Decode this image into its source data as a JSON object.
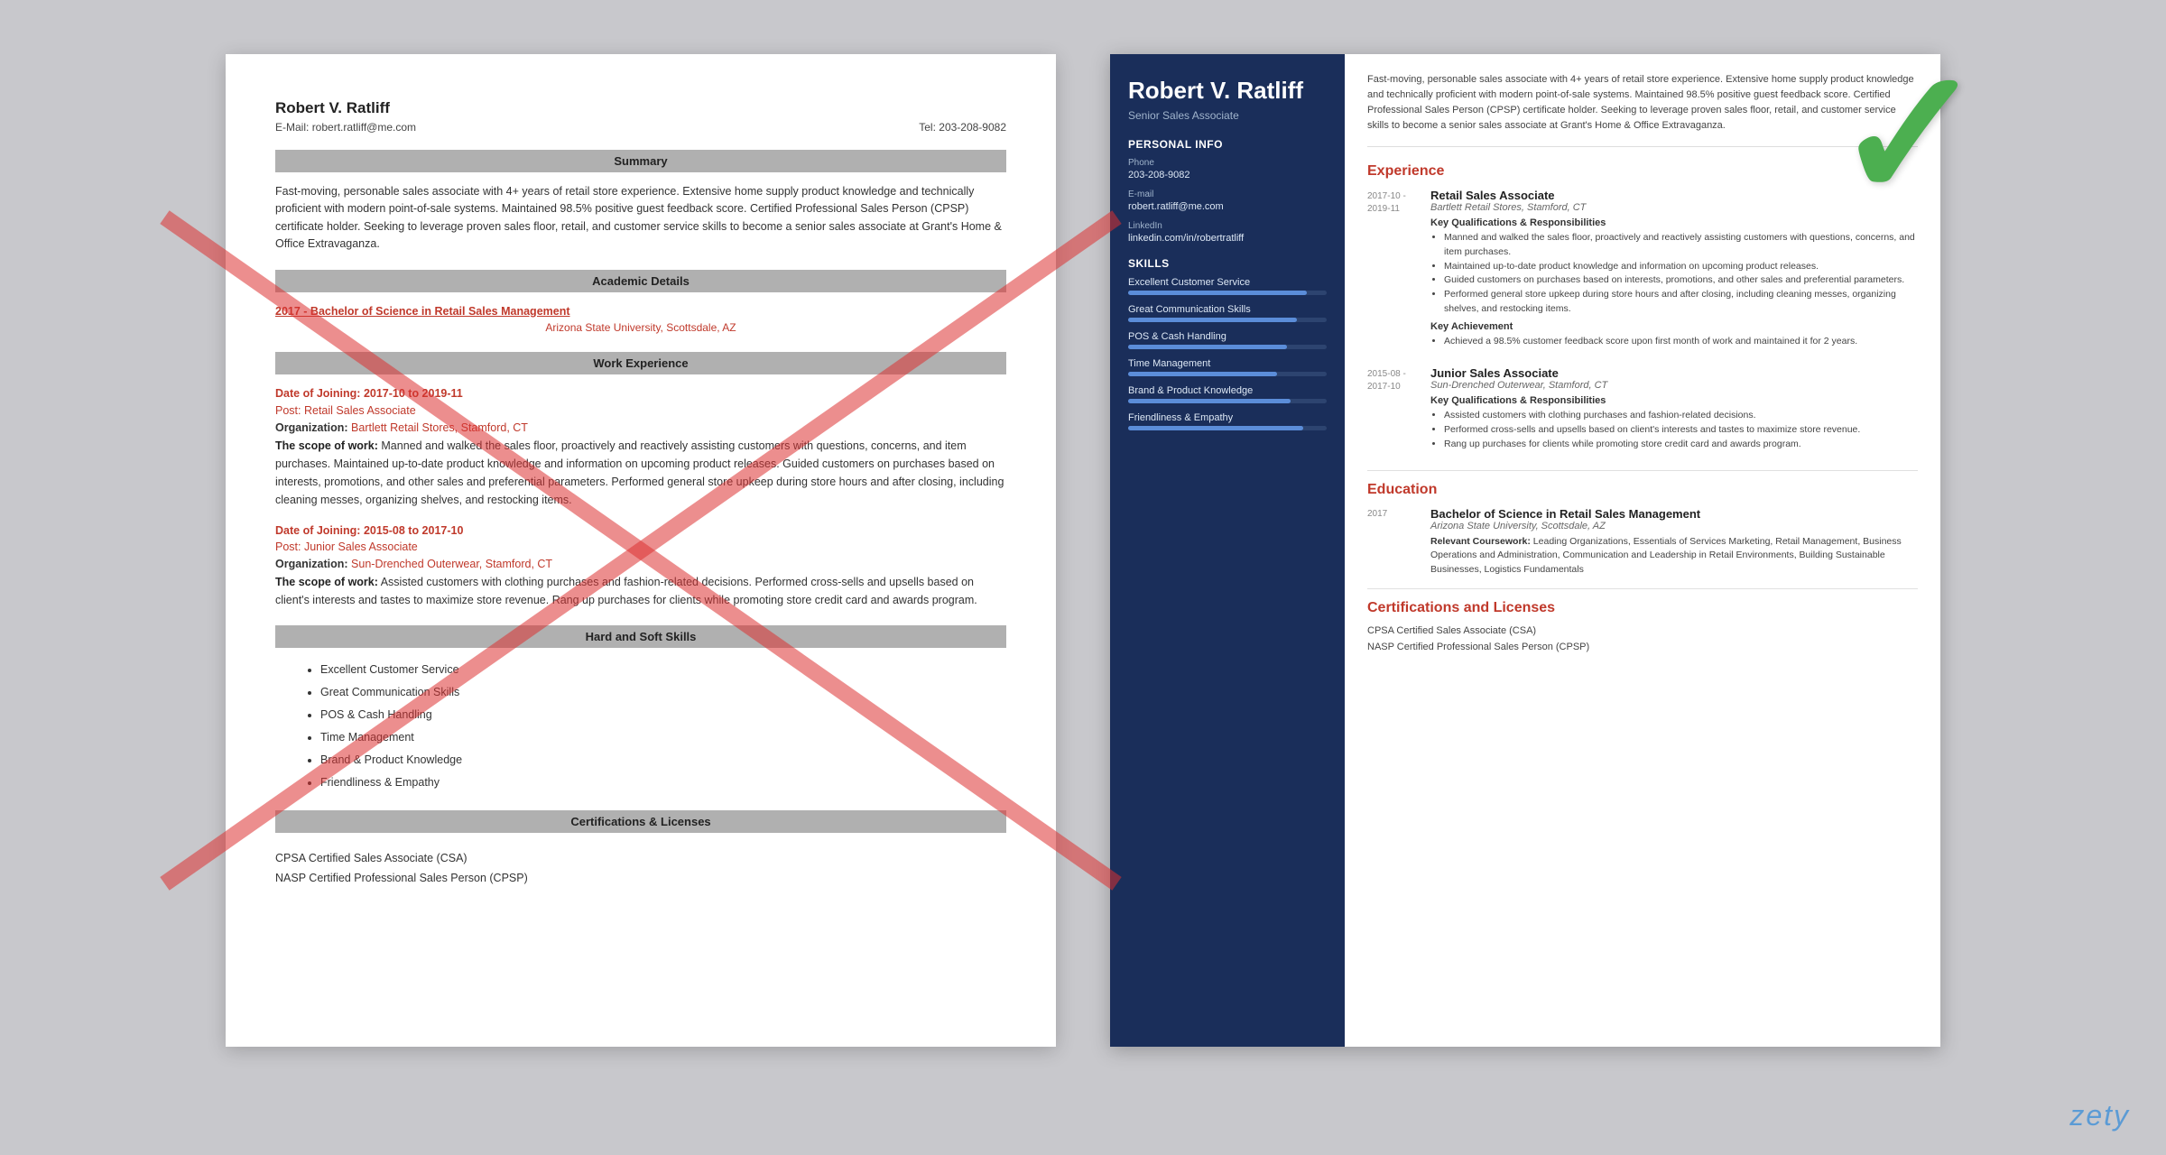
{
  "bad_resume": {
    "header": {
      "name": "Robert V. Ratliff",
      "email_label": "E-Mail:",
      "email": "robert.ratliff@me.com",
      "tel_label": "Tel:",
      "phone": "203-208-9082"
    },
    "sections": {
      "summary_title": "Summary",
      "summary_text": "Fast-moving, personable sales associate with 4+ years of retail store experience. Extensive home supply product knowledge and technically proficient with modern point-of-sale systems. Maintained 98.5% positive guest feedback score. Certified Professional Sales Person (CPSP) certificate holder. Seeking to leverage proven sales floor, retail, and customer service skills to become a senior sales associate at Grant's Home & Office Extravaganza.",
      "academic_title": "Academic Details",
      "academic_degree": "2017 - Bachelor of Science in Retail Sales Management",
      "academic_school": "Arizona State University, Scottsdale, AZ",
      "work_title": "Work Experience",
      "jobs": [
        {
          "date_label": "Date of Joining:",
          "dates": "2017-10 to 2019-11",
          "post_label": "Post:",
          "post": "Retail Sales Associate",
          "org_label": "Organization:",
          "org": "Bartlett Retail Stores, Stamford, CT",
          "scope_label": "The scope of work:",
          "scope": "Manned and walked the sales floor, proactively and reactively assisting customers with questions, concerns, and item purchases. Maintained up-to-date product knowledge and information on upcoming product releases. Guided customers on purchases based on interests, promotions, and other sales and preferential parameters. Performed general store upkeep during store hours and after closing, including cleaning messes, organizing shelves, and restocking items."
        },
        {
          "date_label": "Date of Joining:",
          "dates": "2015-08 to 2017-10",
          "post_label": "Post:",
          "post": "Junior Sales Associate",
          "org_label": "Organization:",
          "org": "Sun-Drenched Outerwear, Stamford, CT",
          "scope_label": "The scope of work:",
          "scope": "Assisted customers with clothing purchases and fashion-related decisions. Performed cross-sells and upsells based on client's interests and tastes to maximize store revenue. Rang up purchases for clients while promoting store credit card and awards program."
        }
      ],
      "skills_title": "Hard and Soft Skills",
      "skills": [
        "Excellent Customer Service",
        "Great Communication Skills",
        "POS & Cash Handling",
        "Time Management",
        "Brand & Product Knowledge",
        "Friendliness & Empathy"
      ],
      "certs_title": "Certifications & Licenses",
      "certs": [
        "CPSA Certified Sales Associate (CSA)",
        "NASP Certified Professional Sales Person (CPSP)"
      ]
    }
  },
  "good_resume": {
    "sidebar": {
      "name": "Robert V. Ratliff",
      "title": "Senior Sales Associate",
      "personal_title": "Personal Info",
      "phone_label": "Phone",
      "phone": "203-208-9082",
      "email_label": "E-mail",
      "email": "robert.ratliff@me.com",
      "linkedin_label": "LinkedIn",
      "linkedin": "linkedin.com/in/robertratliff",
      "skills_title": "Skills",
      "skills": [
        {
          "name": "Excellent Customer Service",
          "pct": 90
        },
        {
          "name": "Great Communication Skills",
          "pct": 85
        },
        {
          "name": "POS & Cash Handling",
          "pct": 80
        },
        {
          "name": "Time Management",
          "pct": 75
        },
        {
          "name": "Brand & Product Knowledge",
          "pct": 82
        },
        {
          "name": "Friendliness & Empathy",
          "pct": 88
        }
      ]
    },
    "main": {
      "summary": "Fast-moving, personable sales associate with 4+ years of retail store experience. Extensive home supply product knowledge and technically proficient with modern point-of-sale systems. Maintained 98.5% positive guest feedback score. Certified Professional Sales Person (CPSP) certificate holder. Seeking to leverage proven sales floor, retail, and customer service skills to become a senior sales associate at Grant's Home & Office Extravaganza.",
      "experience_title": "Experience",
      "jobs": [
        {
          "dates": "2017-10 - 2019-11",
          "title": "Retail Sales Associate",
          "org": "Bartlett Retail Stores, Stamford, CT",
          "key_qual_title": "Key Qualifications & Responsibilities",
          "bullets": [
            "Manned and walked the sales floor, proactively and reactively assisting customers with questions, concerns, and item purchases.",
            "Maintained up-to-date product knowledge and information on upcoming product releases.",
            "Guided customers on purchases based on interests, promotions, and other sales and preferential parameters.",
            "Performed general store upkeep during store hours and after closing, including cleaning messes, organizing shelves, and restocking items."
          ],
          "achievement_title": "Key Achievement",
          "achievement": "Achieved a 98.5% customer feedback score upon first month of work and maintained it for 2 years."
        },
        {
          "dates": "2015-08 - 2017-10",
          "title": "Junior Sales Associate",
          "org": "Sun-Drenched Outerwear, Stamford, CT",
          "key_qual_title": "Key Qualifications & Responsibilities",
          "bullets": [
            "Assisted customers with clothing purchases and fashion-related decisions.",
            "Performed cross-sells and upsells based on client's interests and tastes to maximize store revenue.",
            "Rang up purchases for clients while promoting store credit card and awards program."
          ]
        }
      ],
      "education_title": "Education",
      "education": [
        {
          "year": "2017",
          "degree": "Bachelor of Science in Retail Sales Management",
          "school": "Arizona State University, Scottsdale, AZ",
          "coursework_label": "Relevant Coursework:",
          "coursework": "Leading Organizations, Essentials of Services Marketing, Retail Management, Business Operations and Administration, Communication and Leadership in Retail Environments, Building Sustainable Businesses, Logistics Fundamentals"
        }
      ],
      "certs_title": "Certifications and Licenses",
      "certs": [
        "CPSA Certified Sales Associate (CSA)",
        "NASP Certified Professional Sales Person (CPSP)"
      ]
    }
  },
  "watermark": "zety"
}
